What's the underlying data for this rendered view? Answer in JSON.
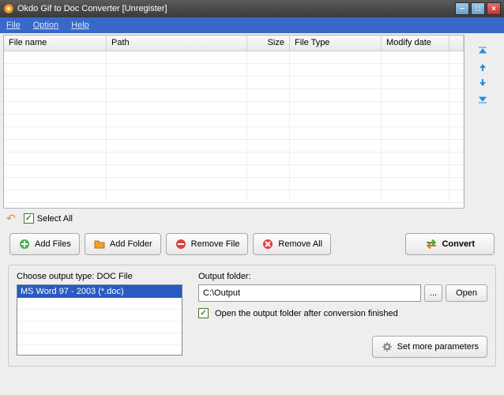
{
  "titlebar": {
    "title": "Okdo Gif to Doc Converter [Unregister]"
  },
  "menu": {
    "file": "File",
    "option": "Option",
    "help": "Help"
  },
  "table": {
    "cols": {
      "filename": "File name",
      "path": "Path",
      "size": "Size",
      "filetype": "File Type",
      "modify": "Modify date"
    }
  },
  "toolbar": {
    "select_all": "Select All",
    "add_files": "Add Files",
    "add_folder": "Add Folder",
    "remove_file": "Remove File",
    "remove_all": "Remove All",
    "convert": "Convert"
  },
  "output": {
    "type_label": "Choose output type:  DOC File",
    "listbox_item": "MS Word 97 - 2003 (*.doc)",
    "folder_label": "Output folder:",
    "folder_value": "C:\\Output",
    "browse": "...",
    "open": "Open",
    "open_after": "Open the output folder after conversion finished",
    "set_params": "Set more parameters"
  }
}
